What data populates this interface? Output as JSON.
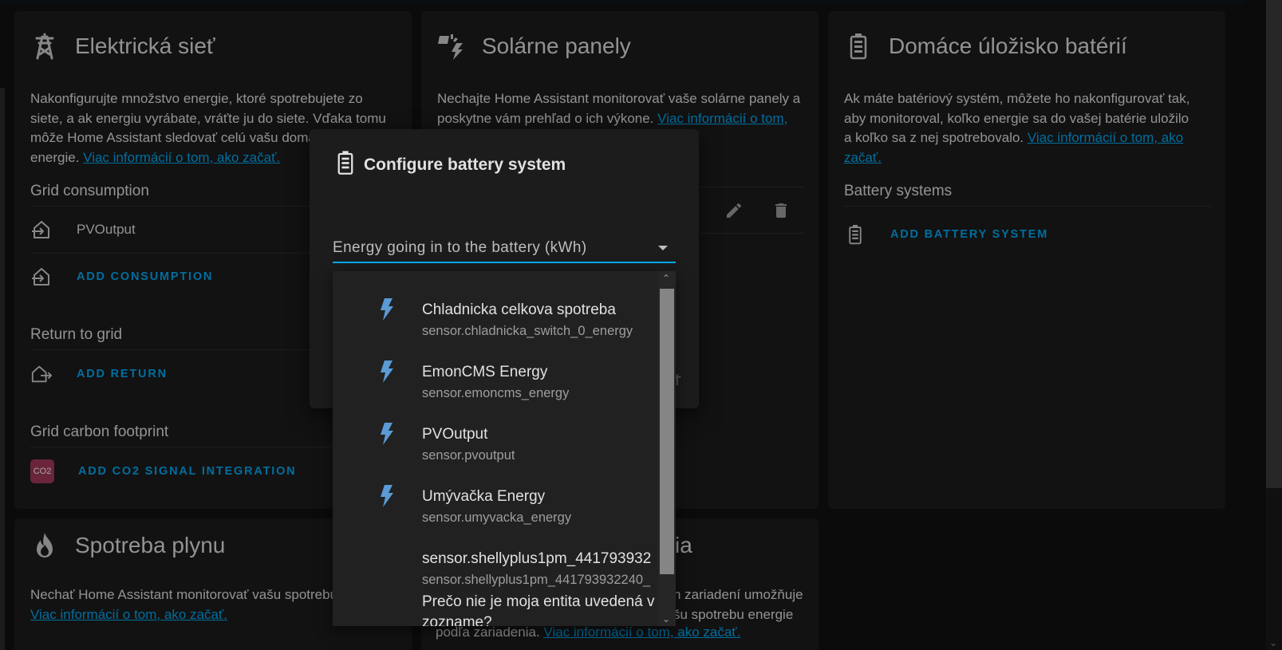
{
  "grid_card": {
    "title": "Elektrická sieť",
    "description": "Nakonfigurujte množstvo energie, ktoré spotrebujete zo siete, a ak energiu vyrábate, vráťte ju do siete. Vďaka tomu môže Home Assistant sledovať celú vašu domácu spotrebu energie.",
    "learn_more": "Viac informácií o tom, ako začať.",
    "consumption_label": "Grid consumption",
    "consumption_source": "PVOutput",
    "add_consumption": "ADD CONSUMPTION",
    "return_label": "Return to grid",
    "add_return": "ADD RETURN",
    "carbon_label": "Grid carbon footprint",
    "add_co2": "ADD CO2 SIGNAL INTEGRATION",
    "co2_logo_text": "CO2"
  },
  "solar_card": {
    "title": "Solárne panely",
    "description": "Nechajte Home Assistant monitorovať vaše solárne panely a poskytne vám prehľad o ich výkone.",
    "learn_more": "Viac informácií o tom, ako začať."
  },
  "battery_card": {
    "title": "Domáce úložisko batérií",
    "description": "Ak máte batériový systém, môžete ho nakonfigurovať tak, aby monitoroval, koľko energie sa do vašej batérie uložilo a koľko sa z nej spotrebovalo.",
    "learn_more": "Viac informácií o tom, ako začať.",
    "systems_label": "Battery systems",
    "add_battery": "ADD BATTERY SYSTEM"
  },
  "gas_card": {
    "title": "Spotreba plynu",
    "description": "Nechať Home Assistant monitorovať vašu spotrebu",
    "learn_more": "Viac informácií o tom, ako začať."
  },
  "devices_card": {
    "title_partial": "ia",
    "description_partial": "h zariadení umožňuje",
    "description_partial2": "šu spotrebu energie",
    "description_partial3": "podľa zariadenia.",
    "learn_more": "Viac informácií o tom, ako začať."
  },
  "dialog": {
    "title": "Configure battery system",
    "field_placeholder": "Energy going in to the battery (kWh)",
    "field_value": ""
  },
  "dropdown": {
    "options": [
      {
        "name": "Chladnicka celkova spotreba",
        "entity": "sensor.chladnicka_switch_0_energy",
        "icon": "flash-icon"
      },
      {
        "name": "EmonCMS Energy",
        "entity": "sensor.emoncms_energy",
        "icon": "flash-icon"
      },
      {
        "name": "PVOutput",
        "entity": "sensor.pvoutput",
        "icon": "flash-icon"
      },
      {
        "name": "Umývačka Energy",
        "entity": "sensor.umyvacka_energy",
        "icon": "flash-icon"
      },
      {
        "name": "sensor.shellyplus1pm_441793932",
        "entity": "sensor.shellyplus1pm_441793932240_"
      }
    ],
    "help_text": "Prečo nie je moja entita uvedená v zozname?"
  },
  "colors": {
    "accent": "#03a9f4",
    "card_bg": "#1c1c1c",
    "page_bg": "#111111",
    "flash_icon": "#5b9bd5"
  }
}
